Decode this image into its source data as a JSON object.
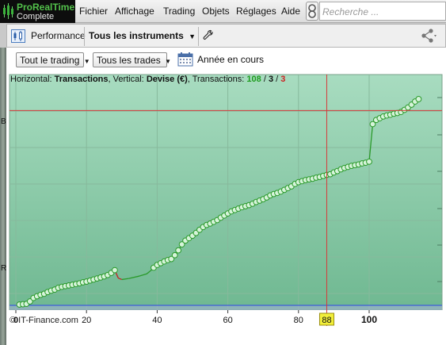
{
  "app": {
    "name": "ProRealTime",
    "edition": "Complete"
  },
  "menu": {
    "items": [
      {
        "label": "Fichier"
      },
      {
        "label": "Affichage"
      },
      {
        "label": "Trading"
      },
      {
        "label": "Objets"
      },
      {
        "label": "Réglages"
      },
      {
        "label": "Aide"
      }
    ],
    "search_placeholder": "Recherche ..."
  },
  "toolbar": {
    "performance_label": "Performance",
    "instrument_selector": "Tous les instruments",
    "icons": [
      "performance-icon",
      "wrench-icon",
      "share-icon"
    ]
  },
  "filters": {
    "trading_dropdown": "Tout le trading",
    "trades_dropdown": "Tous les trades",
    "period_label": "Année en cours"
  },
  "legend": {
    "horizontal_prefix": "Horizontal:",
    "horizontal_value": "Transactions",
    "vertical_prefix": ", Vertical:",
    "vertical_value": "Devise (€)",
    "transactions_prefix": ", Transactions:",
    "total": "108",
    "sep1": " / ",
    "middle": "3",
    "sep2": " / ",
    "losers": "3"
  },
  "watermark": "© IT-Finance.com",
  "left_edge_letters": [
    "B",
    "R"
  ],
  "colors": {
    "plot_bg_top": "#a8dcc0",
    "plot_bg_bottom": "#6fb891",
    "curve_green": "#2a9a2a",
    "curve_red": "#c22222",
    "cursor_red": "#d63b3b",
    "baseline_blue": "#3f5fd8",
    "cursor_badge": "#f2ef3a"
  },
  "chart_data": {
    "type": "line",
    "title": "",
    "xlabel": "Transactions",
    "ylabel": "Devise (€)",
    "xlim": [
      -2,
      122
    ],
    "x_ticks": [
      0,
      20,
      40,
      60,
      80,
      100
    ],
    "cursor_x": 88,
    "cursor_label": "88",
    "grid": true,
    "series": [
      {
        "points": [
          [
            1,
            0.0
          ],
          [
            2,
            0.1
          ],
          [
            3,
            0.2
          ],
          [
            4,
            0.9
          ],
          [
            5,
            1.9
          ],
          [
            6,
            2.4
          ],
          [
            7,
            2.8
          ],
          [
            8,
            3.1
          ],
          [
            9,
            3.6
          ],
          [
            10,
            4.0
          ],
          [
            11,
            4.3
          ],
          [
            12,
            4.8
          ],
          [
            13,
            5.1
          ],
          [
            14,
            5.3
          ],
          [
            15,
            5.5
          ],
          [
            16,
            5.7
          ],
          [
            17,
            5.9
          ],
          [
            18,
            6.1
          ],
          [
            19,
            6.4
          ],
          [
            20,
            6.6
          ],
          [
            21,
            6.9
          ],
          [
            22,
            7.2
          ],
          [
            23,
            7.5
          ],
          [
            24,
            7.8
          ],
          [
            25,
            8.1
          ],
          [
            26,
            8.5
          ],
          [
            27,
            9.1
          ],
          [
            28,
            9.9
          ],
          [
            29,
            7.6
          ],
          [
            30,
            7.2
          ],
          [
            32,
            7.5
          ],
          [
            35,
            8.2
          ],
          [
            37,
            8.8
          ],
          [
            38,
            9.6
          ],
          [
            39,
            10.6
          ],
          [
            40,
            11.4
          ],
          [
            41,
            11.9
          ],
          [
            42,
            12.4
          ],
          [
            43,
            12.8
          ],
          [
            44,
            13.1
          ],
          [
            45,
            14.2
          ],
          [
            46,
            15.6
          ],
          [
            47,
            17.3
          ],
          [
            48,
            18.4
          ],
          [
            49,
            19.1
          ],
          [
            50,
            19.8
          ],
          [
            51,
            20.6
          ],
          [
            52,
            21.5
          ],
          [
            53,
            22.3
          ],
          [
            54,
            22.9
          ],
          [
            55,
            23.3
          ],
          [
            56,
            23.8
          ],
          [
            57,
            24.3
          ],
          [
            58,
            25.0
          ],
          [
            59,
            25.6
          ],
          [
            60,
            26.2
          ],
          [
            61,
            26.8
          ],
          [
            62,
            27.2
          ],
          [
            63,
            27.6
          ],
          [
            64,
            28.0
          ],
          [
            65,
            28.3
          ],
          [
            66,
            28.6
          ],
          [
            67,
            29.0
          ],
          [
            68,
            29.5
          ],
          [
            69,
            29.9
          ],
          [
            70,
            30.3
          ],
          [
            71,
            30.8
          ],
          [
            72,
            31.4
          ],
          [
            73,
            31.8
          ],
          [
            74,
            32.1
          ],
          [
            75,
            32.5
          ],
          [
            76,
            33.0
          ],
          [
            77,
            33.5
          ],
          [
            78,
            34.0
          ],
          [
            79,
            34.7
          ],
          [
            80,
            35.2
          ],
          [
            81,
            35.5
          ],
          [
            82,
            35.8
          ],
          [
            83,
            36.0
          ],
          [
            84,
            36.2
          ],
          [
            85,
            36.5
          ],
          [
            86,
            36.7
          ],
          [
            87,
            37.0
          ],
          [
            88,
            37.3
          ],
          [
            89,
            37.5
          ],
          [
            90,
            38.0
          ],
          [
            91,
            38.4
          ],
          [
            92,
            38.9
          ],
          [
            93,
            39.3
          ],
          [
            94,
            39.6
          ],
          [
            95,
            39.9
          ],
          [
            96,
            40.1
          ],
          [
            97,
            40.3
          ],
          [
            98,
            40.6
          ],
          [
            99,
            40.8
          ],
          [
            100,
            41.1
          ],
          [
            101,
            51.9
          ],
          [
            102,
            53.1
          ],
          [
            103,
            53.6
          ],
          [
            104,
            54.1
          ],
          [
            105,
            54.4
          ],
          [
            106,
            54.6
          ],
          [
            107,
            54.9
          ],
          [
            108,
            55.1
          ],
          [
            109,
            55.4
          ],
          [
            110,
            56.0
          ],
          [
            111,
            56.7
          ],
          [
            112,
            57.5
          ],
          [
            113,
            58.4
          ],
          [
            114,
            59.1
          ]
        ]
      }
    ],
    "loss_segments": [
      [
        28,
        30
      ]
    ],
    "crosshair_y": 55.8,
    "baseline_y": 0
  }
}
